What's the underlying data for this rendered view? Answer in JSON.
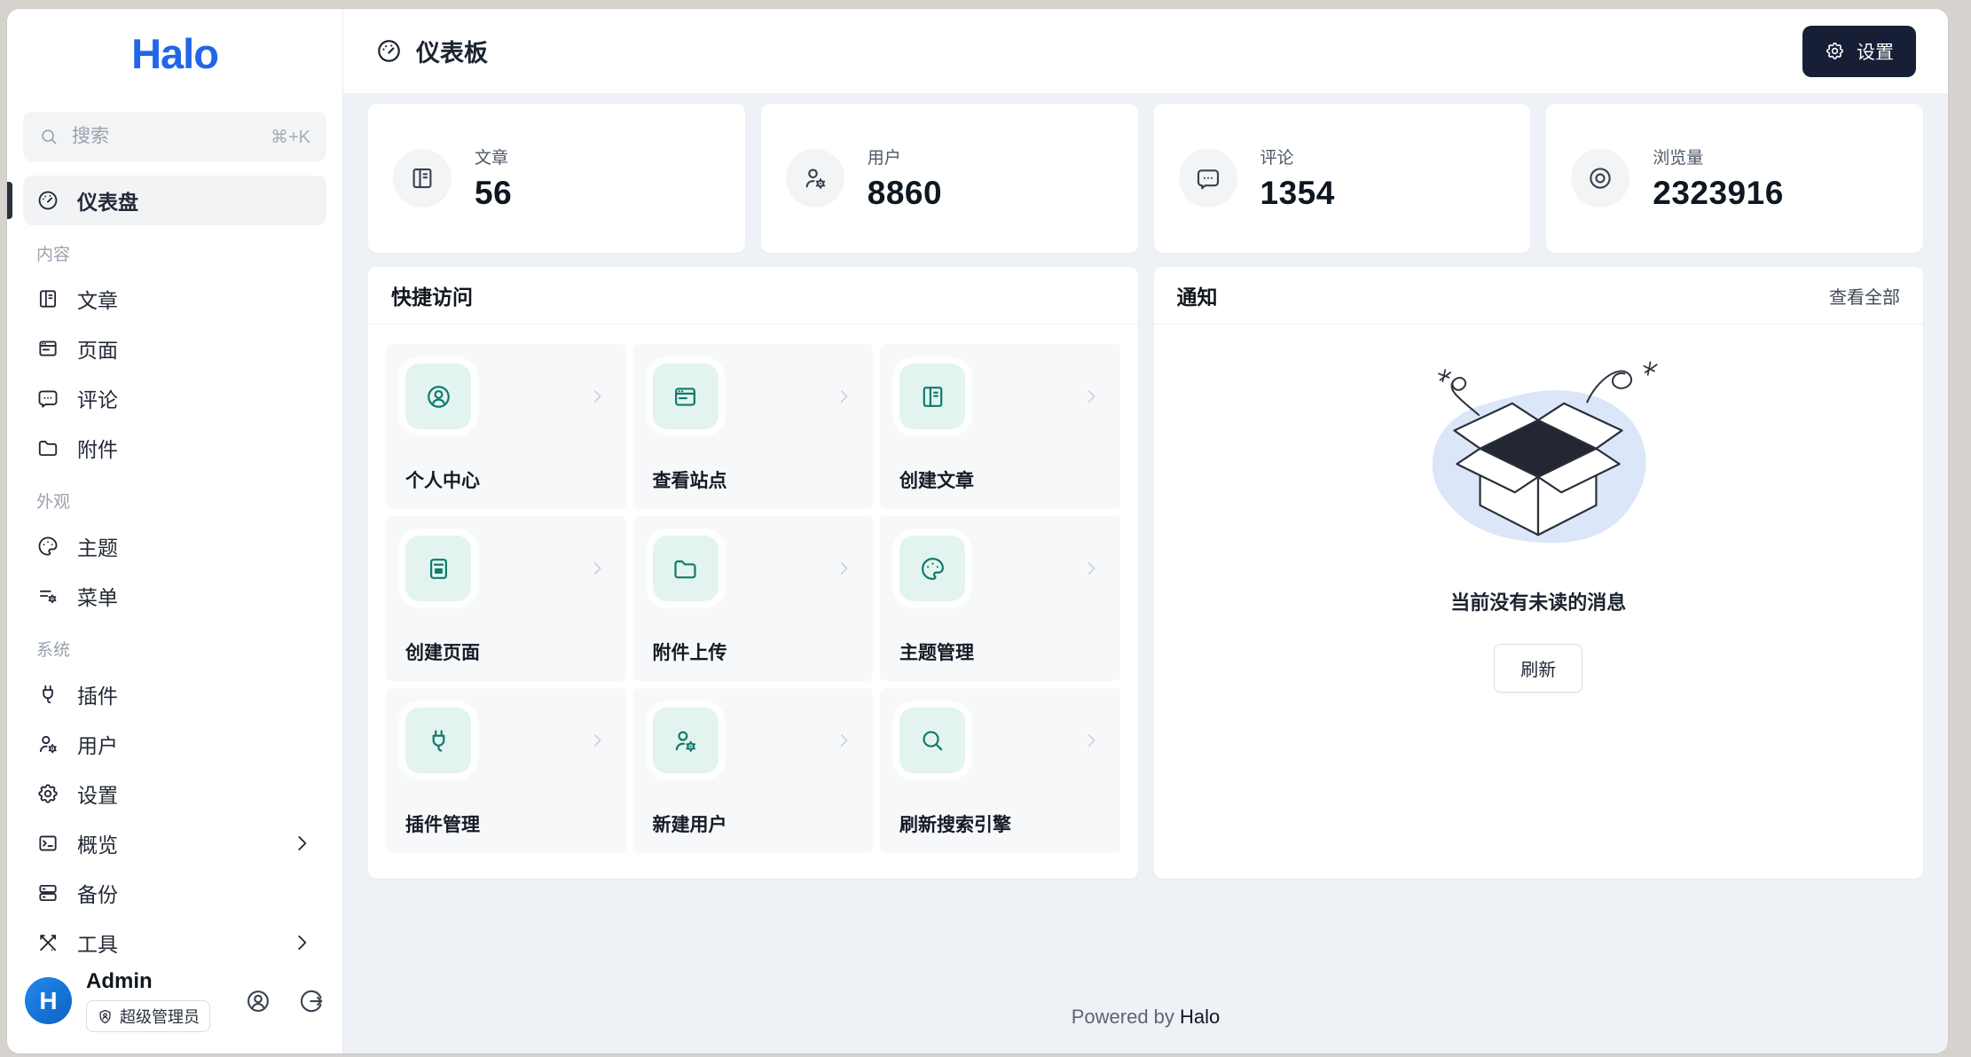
{
  "colors": {
    "brand-blue": "#2166e8",
    "accent-teal": "#0e7a6b",
    "accent-teal-bg": "#e3f4f0",
    "dark-navy": "#171f37",
    "content-bg": "#eef2f7"
  },
  "brand": {
    "logo_text": "Halo"
  },
  "sidebar": {
    "search": {
      "placeholder": "搜索",
      "shortcut": "⌘+K",
      "icon": "search-icon"
    },
    "active_item": {
      "label": "仪表盘",
      "icon": "gauge-icon"
    },
    "sections": [
      {
        "label": "内容",
        "items": [
          {
            "label": "文章",
            "icon": "book-icon"
          },
          {
            "label": "页面",
            "icon": "browser-icon"
          },
          {
            "label": "评论",
            "icon": "message-icon"
          },
          {
            "label": "附件",
            "icon": "folder-icon"
          }
        ]
      },
      {
        "label": "外观",
        "items": [
          {
            "label": "主题",
            "icon": "palette-icon"
          },
          {
            "label": "菜单",
            "icon": "menu-settings-icon"
          }
        ]
      },
      {
        "label": "系统",
        "items": [
          {
            "label": "插件",
            "icon": "plug-icon"
          },
          {
            "label": "用户",
            "icon": "user-gear-icon"
          },
          {
            "label": "设置",
            "icon": "gear-icon"
          },
          {
            "label": "概览",
            "icon": "terminal-icon",
            "chevron": true
          },
          {
            "label": "备份",
            "icon": "server-icon"
          },
          {
            "label": "工具",
            "icon": "tools-icon",
            "chevron": true
          }
        ]
      }
    ],
    "user": {
      "name": "Admin",
      "avatar_letter": "H",
      "role_badge": "超级管理员",
      "role_icon": "shield-user-icon",
      "profile_icon": "user-circle-icon",
      "logout_icon": "logout-icon"
    }
  },
  "header": {
    "title": "仪表板",
    "icon": "gauge-icon",
    "settings_button": {
      "label": "设置",
      "icon": "gear-icon"
    }
  },
  "stats": [
    {
      "label": "文章",
      "value": "56",
      "icon": "book-icon"
    },
    {
      "label": "用户",
      "value": "8860",
      "icon": "user-gear-icon"
    },
    {
      "label": "评论",
      "value": "1354",
      "icon": "message-icon"
    },
    {
      "label": "浏览量",
      "value": "2323916",
      "icon": "focus-icon"
    }
  ],
  "quick_access": {
    "title": "快捷访问",
    "tiles": [
      {
        "label": "个人中心",
        "icon": "user-circle-icon"
      },
      {
        "label": "查看站点",
        "icon": "browser-icon"
      },
      {
        "label": "创建文章",
        "icon": "book-icon"
      },
      {
        "label": "创建页面",
        "icon": "notes-icon"
      },
      {
        "label": "附件上传",
        "icon": "folder-icon"
      },
      {
        "label": "主题管理",
        "icon": "palette-icon"
      },
      {
        "label": "插件管理",
        "icon": "plug-icon"
      },
      {
        "label": "新建用户",
        "icon": "user-gear-icon"
      },
      {
        "label": "刷新搜索引擎",
        "icon": "search-icon"
      }
    ]
  },
  "notifications": {
    "title": "通知",
    "view_all": "查看全部",
    "empty_message": "当前没有未读的消息",
    "refresh_button": "刷新"
  },
  "footer": {
    "powered_by": "Powered by",
    "brand": "Halo"
  }
}
